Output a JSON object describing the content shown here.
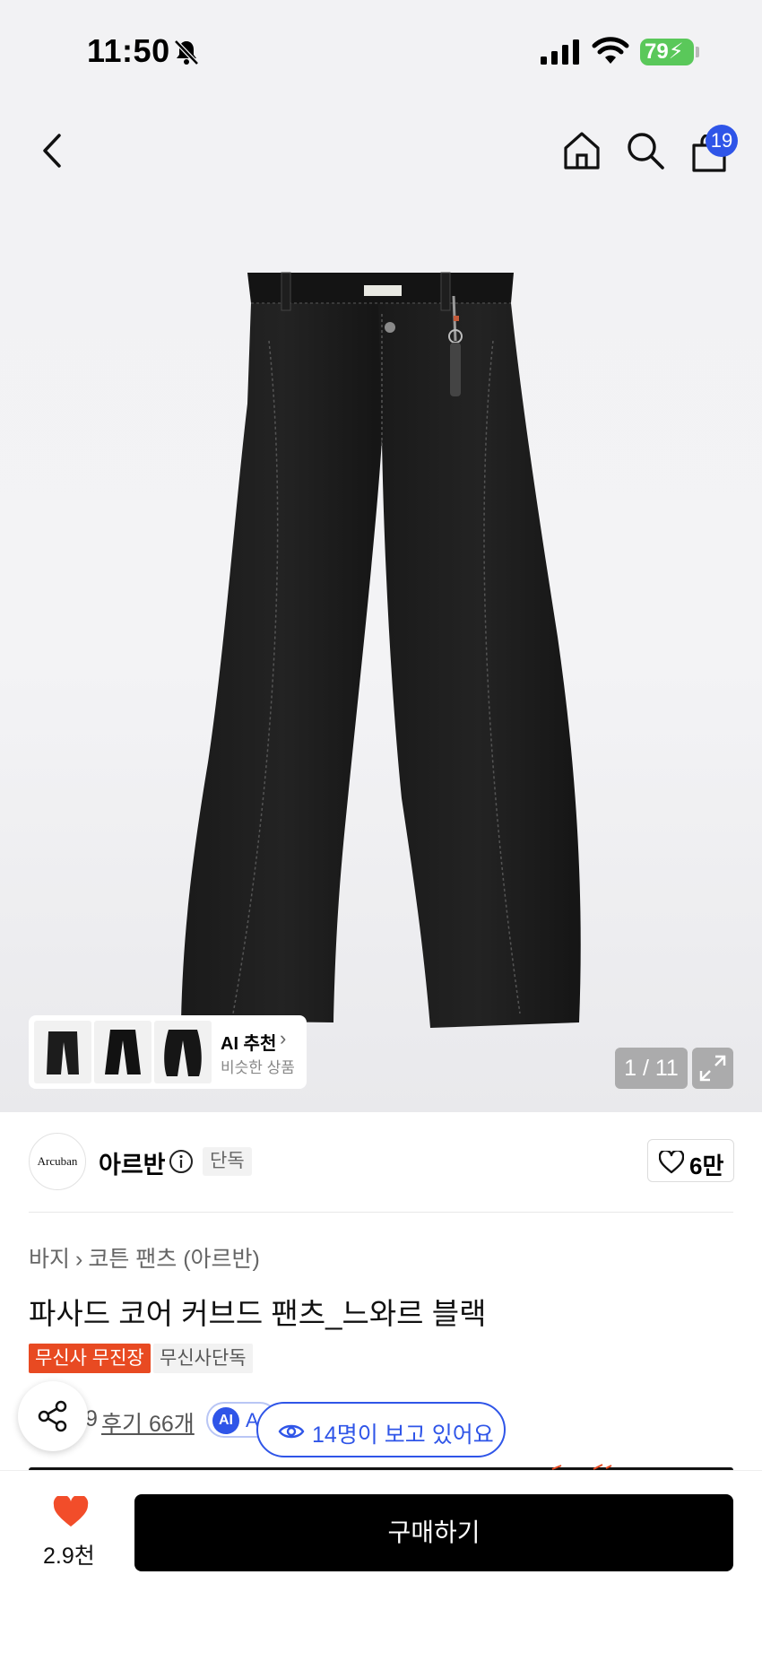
{
  "status_bar": {
    "time": "11:50",
    "battery": "79"
  },
  "header": {
    "cart_count": "19"
  },
  "gallery": {
    "page_counter": "1 / 11",
    "ai_recommend": {
      "title": "AI 추천",
      "subtitle": "비슷한 상품"
    }
  },
  "brand": {
    "logo_text": "Arcuban",
    "name": "아르반",
    "exclusive_tag": "단독",
    "like_count": "6만"
  },
  "product": {
    "breadcrumb": [
      "바지",
      "코튼 팬츠 (아르반)"
    ],
    "title": "파사드 코어 커브드 팬츠_느와르 블랙",
    "tags": [
      "무신사 무진장",
      "무신사단독"
    ],
    "rating_partial": ".9",
    "review_label": "후기 66개",
    "ai_chip_icon": "AI",
    "ai_chip_text": "A",
    "viewers": "14명이 보고 있어요"
  },
  "bottom_bar": {
    "wish_count": "2.9천",
    "buy_label": "구매하기"
  },
  "colors": {
    "accent_blue": "#2f55e8",
    "tag_red": "#e84a22",
    "heart_red": "#f24d2a",
    "battery_green": "#5ac85a"
  },
  "icons": [
    "bell-slash-icon",
    "signal-icon",
    "wifi-icon",
    "back-icon",
    "home-icon",
    "search-icon",
    "cart-icon",
    "expand-icon",
    "info-icon",
    "heart-outline-icon",
    "eye-icon",
    "share-icon",
    "heart-filled-icon",
    "chevron-right-icon"
  ]
}
